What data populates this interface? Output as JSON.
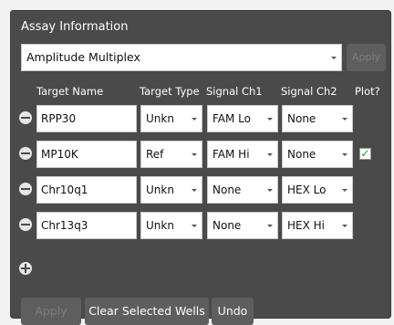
{
  "assay": {
    "title": "Assay Information",
    "selected": "Amplitude Multiplex",
    "apply_label": "Apply"
  },
  "headers": {
    "target_name": "Target Name",
    "target_type": "Target Type",
    "signal_ch1": "Signal Ch1",
    "signal_ch2": "Signal Ch2",
    "plot": "Plot?"
  },
  "rows": [
    {
      "name": "RPP30",
      "type": "Unkn",
      "ch1": "FAM Lo",
      "ch2": "None",
      "plot": false
    },
    {
      "name": "MP10K",
      "type": "Ref",
      "ch1": "FAM Hi",
      "ch2": "None",
      "plot": true
    },
    {
      "name": "Chr10q1",
      "type": "Unkn",
      "ch1": "None",
      "ch2": "HEX Lo",
      "plot": false
    },
    {
      "name": "Chr13q3",
      "type": "Unkn",
      "ch1": "None",
      "ch2": "HEX Hi",
      "plot": false
    }
  ],
  "footer": {
    "apply_label": "Apply",
    "clear_label": "Clear Selected Wells",
    "undo_label": "Undo"
  },
  "check_mark": "✓"
}
